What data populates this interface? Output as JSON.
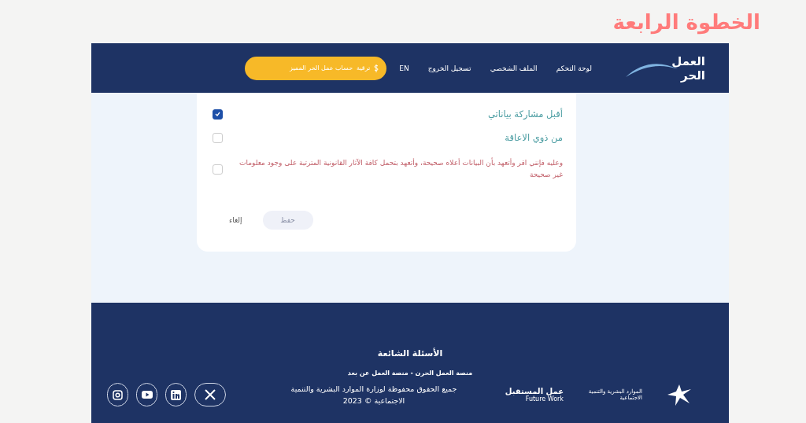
{
  "page_heading": "الخطوة الرابعة",
  "header": {
    "logo": {
      "line_1": "العمل",
      "line_2": "الحر"
    },
    "nav": [
      {
        "label": "لوحة التحكم"
      },
      {
        "label": "الملف الشخصي"
      },
      {
        "label": "تسجيل الخروج"
      },
      {
        "label": "EN"
      }
    ],
    "upgrade_button": {
      "tag": "ترقية",
      "label": "حساب عمل الحر المميز"
    }
  },
  "form": {
    "options": [
      {
        "kind": "consent",
        "label": "أقبل مشاركة بياناتي",
        "checked": true
      },
      {
        "kind": "consent",
        "label": "من ذوي الاعاقة",
        "checked": false
      },
      {
        "kind": "warning",
        "label": "وعليه فإنني اقر وأتعهد بأن البيانات أعلاه صحيحة، وأتعهد بتحمل كافة الآثار القانونية المترتبة على وجود معلومات غير صحيحة",
        "checked": false
      }
    ],
    "buttons": [
      {
        "label": "حفظ",
        "kind": "primary",
        "disabled": true
      },
      {
        "label": "إلغاء",
        "kind": "link",
        "disabled": false
      }
    ]
  },
  "footer": {
    "faq": "الأسئلة الشائعة",
    "tagline": "منصة العمل الحرن - منصة العمل عن بعد",
    "copyright": "جميع الحقوق محفوظة لوزارة الموارد البشرية والتنمية الاجتماعية © 2023",
    "ministry_logo": "الموارد البشرية والتنمية الاجتماعية",
    "future_logo": {
      "arabic": "عمل المستقبل",
      "english": "Future Work"
    },
    "social": [
      {
        "kind": "x"
      },
      {
        "kind": "linkedin"
      },
      {
        "kind": "youtube"
      },
      {
        "kind": "instagram"
      }
    ]
  }
}
